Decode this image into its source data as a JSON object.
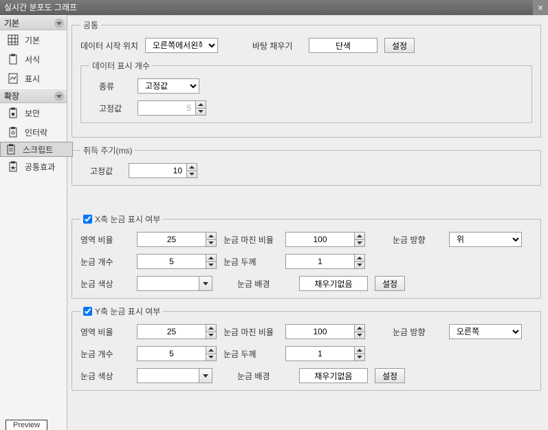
{
  "window": {
    "title": "실시간 분포도 그래프"
  },
  "sidebar": {
    "group1": "기본",
    "group2": "확장",
    "items1": [
      {
        "label": "기본"
      },
      {
        "label": "서식"
      },
      {
        "label": "표시"
      }
    ],
    "items2": [
      {
        "label": "보안"
      },
      {
        "label": "인터락"
      },
      {
        "label": "스크립트"
      },
      {
        "label": "공통효과"
      }
    ],
    "preview": "Preview"
  },
  "common": {
    "legend": "공통",
    "startPosLabel": "데이터 시작 위치",
    "startPosValue": "오른쪽에서왼쪽",
    "bgFillLabel": "바탕 채우기",
    "bgFillValue": "단색",
    "settingBtn": "설정",
    "displayCount": {
      "legend": "데이터 표시 개수",
      "typeLabel": "종류",
      "typeValue": "고정값",
      "fixedLabel": "고정값",
      "fixedValue": "5"
    }
  },
  "acq": {
    "legend": "취득 주기(ms)",
    "fixedLabel": "고정값",
    "fixedValue": "10"
  },
  "xaxis": {
    "checked": true,
    "legend": "X축 눈금 표시 여부",
    "areaRatioLabel": "영역 비율",
    "areaRatio": "25",
    "marginRatioLabel": "눈금 마진 비율",
    "marginRatio": "100",
    "dirLabel": "눈금 방향",
    "dirValue": "위",
    "countLabel": "눈금 개수",
    "count": "5",
    "thickLabel": "눈금 두께",
    "thick": "1",
    "colorLabel": "눈금 색상",
    "bgLabel": "눈금 배경",
    "bgValue": "채우기없음",
    "settingBtn": "설정"
  },
  "yaxis": {
    "checked": true,
    "legend": "Y축 눈금 표시 여부",
    "areaRatioLabel": "영역 비율",
    "areaRatio": "25",
    "marginRatioLabel": "눈금 마진 비율",
    "marginRatio": "100",
    "dirLabel": "눈금 방향",
    "dirValue": "오른쪽",
    "countLabel": "눈금 개수",
    "count": "5",
    "thickLabel": "눈금 두께",
    "thick": "1",
    "colorLabel": "눈금 색상",
    "bgLabel": "눈금 배경",
    "bgValue": "채우기없음",
    "settingBtn": "설정"
  }
}
